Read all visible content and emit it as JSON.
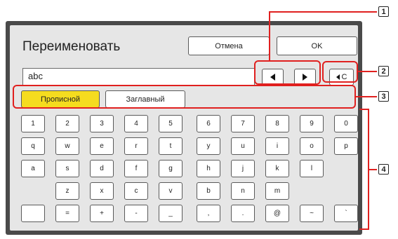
{
  "dialog": {
    "title": "Переименовать",
    "cancel_label": "Отмена",
    "ok_label": "OK",
    "input_value": "abc",
    "backspace_label": "C",
    "mode_upper_label": "Прописной",
    "mode_title_label": "Заглавный"
  },
  "keyboard": {
    "rows": [
      [
        "1",
        "2",
        "3",
        "4",
        "5",
        "6",
        "7",
        "8",
        "9",
        "0"
      ],
      [
        "q",
        "w",
        "e",
        "r",
        "t",
        "y",
        "u",
        "i",
        "o",
        "p"
      ],
      [
        "a",
        "s",
        "d",
        "f",
        "g",
        "h",
        "j",
        "k",
        "l",
        ""
      ],
      [
        "",
        "z",
        "x",
        "c",
        "v",
        "b",
        "n",
        "m",
        "",
        ""
      ],
      [
        "",
        "=",
        "+",
        "-",
        "_",
        ",",
        ".",
        "@",
        "~",
        "`"
      ]
    ]
  },
  "callouts": {
    "labels": [
      "1",
      "2",
      "3",
      "4"
    ]
  },
  "colors": {
    "highlight": "#f5dc1f",
    "callout": "#e0201f",
    "frame": "#4a4a4a",
    "panel": "#e6e6e6"
  }
}
